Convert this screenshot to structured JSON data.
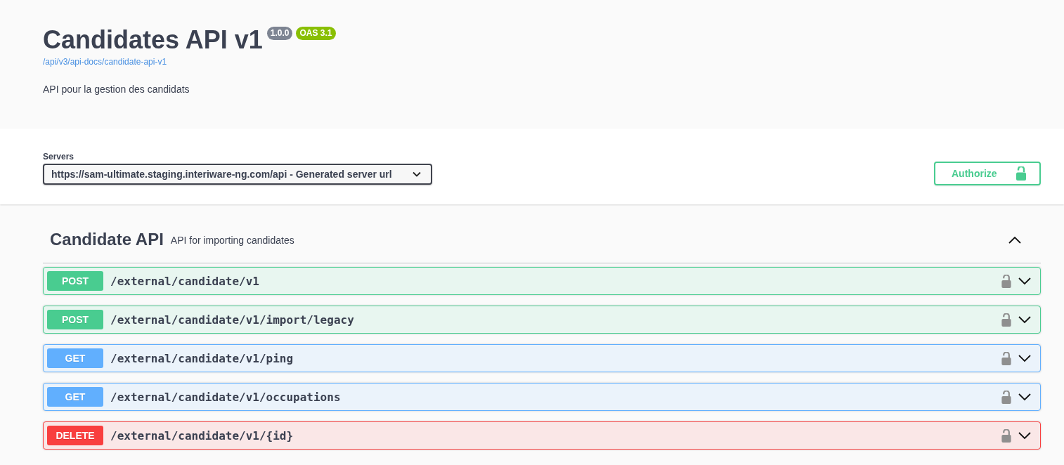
{
  "info": {
    "title": "Candidates API v1",
    "version": "1.0.0",
    "oas_version": "OAS 3.1",
    "spec_link": "/api/v3/api-docs/candidate-api-v1",
    "description": "API pour la gestion des candidats"
  },
  "servers": {
    "label": "Servers",
    "value": "https://sam-ultimate.staging.interiware-ng.com/api - Generated server url"
  },
  "authorize": {
    "label": "Authorize",
    "locked": false
  },
  "tag": {
    "name": "Candidate API",
    "description": "API for importing candidates",
    "expanded": true,
    "operations": [
      {
        "kind": "post",
        "method": "POST",
        "path": "/external/candidate/v1",
        "locked": false,
        "expanded": false
      },
      {
        "kind": "post",
        "method": "POST",
        "path": "/external/candidate/v1/import/legacy",
        "locked": false,
        "expanded": false
      },
      {
        "kind": "get",
        "method": "GET",
        "path": "/external/candidate/v1/ping",
        "locked": false,
        "expanded": false
      },
      {
        "kind": "get",
        "method": "GET",
        "path": "/external/candidate/v1/occupations",
        "locked": false,
        "expanded": false
      },
      {
        "kind": "delete",
        "method": "DELETE",
        "path": "/external/candidate/v1/{id}",
        "locked": false,
        "expanded": false
      }
    ]
  }
}
